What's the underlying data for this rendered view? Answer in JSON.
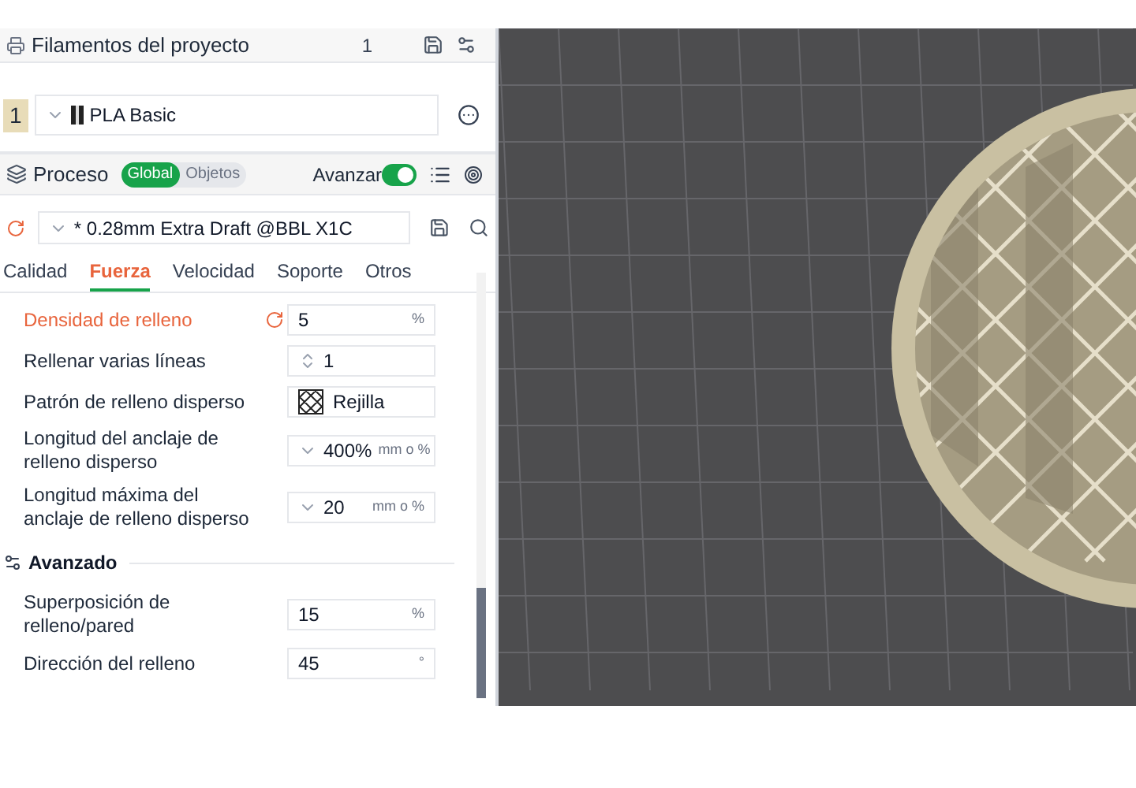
{
  "filaments": {
    "title": "Filamentos del proyecto",
    "count": "1",
    "items": [
      {
        "index": "1",
        "name": "PLA Basic",
        "color": "#e8dcb8"
      }
    ]
  },
  "process": {
    "title": "Proceso",
    "scopes": [
      {
        "label": "Global",
        "selected": true
      },
      {
        "label": "Objetos",
        "selected": false
      }
    ],
    "advanced_label": "Avanzar",
    "advanced_on": true,
    "preset": "* 0.28mm Extra Draft @BBL X1C",
    "preset_modified": true
  },
  "tabs": [
    {
      "label": "Calidad",
      "selected": false
    },
    {
      "label": "Fuerza",
      "selected": true
    },
    {
      "label": "Velocidad",
      "selected": false
    },
    {
      "label": "Soporte",
      "selected": false
    },
    {
      "label": "Otros",
      "selected": false
    }
  ],
  "sections": [
    {
      "settings": [
        {
          "kind": "number",
          "label": "Densidad de relleno",
          "value": "5",
          "unit": "%",
          "modified": true
        },
        {
          "kind": "spin",
          "label": "Rellenar varias líneas",
          "value": "1",
          "modified": false
        },
        {
          "kind": "pattern",
          "label": "Patrón de relleno disperso",
          "value": "Rejilla",
          "modified": false
        },
        {
          "kind": "combo",
          "label": "Longitud del anclaje de relleno disperso",
          "value": "400%",
          "unit": "mm o %",
          "modified": false
        },
        {
          "kind": "combo",
          "label": "Longitud máxima del anclaje de relleno disperso",
          "value": "20",
          "unit": "mm o %",
          "modified": false
        }
      ]
    },
    {
      "title": "Avanzado",
      "settings": [
        {
          "kind": "number",
          "label": "Superposición de relleno/pared",
          "value": "15",
          "unit": "%",
          "modified": false
        },
        {
          "kind": "number",
          "label": "Dirección del relleno",
          "value": "45",
          "unit": "°",
          "modified": false
        }
      ]
    }
  ]
}
